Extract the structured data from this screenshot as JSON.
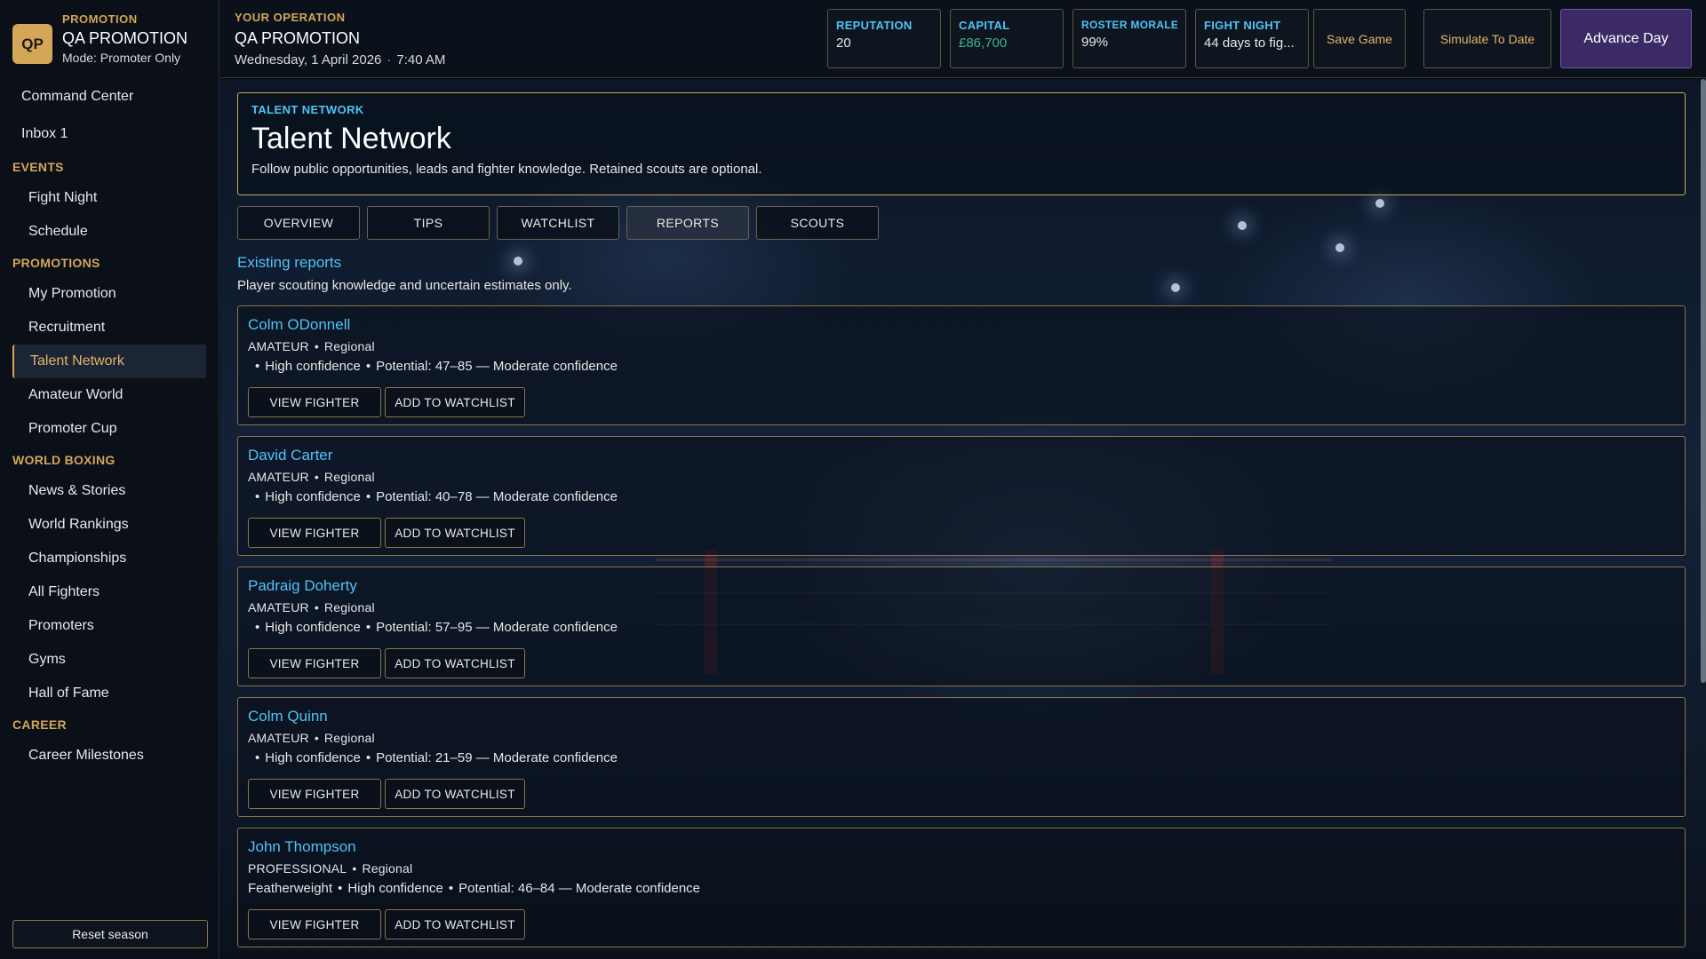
{
  "brand": {
    "logo": "QP",
    "eyebrow": "PROMOTION",
    "name": "QA PROMOTION",
    "mode": "Mode: Promoter Only"
  },
  "sidebar": {
    "top_items": [
      "Command Center",
      "Inbox 1"
    ],
    "sections": [
      {
        "title": "EVENTS",
        "items": [
          "Fight Night",
          "Schedule"
        ]
      },
      {
        "title": "PROMOTIONS",
        "items": [
          "My Promotion",
          "Recruitment",
          "Talent Network",
          "Amateur World",
          "Promoter Cup"
        ]
      },
      {
        "title": "WORLD BOXING",
        "items": [
          "News & Stories",
          "World Rankings",
          "Championships",
          "All Fighters",
          "Promoters",
          "Gyms",
          "Hall of Fame"
        ]
      },
      {
        "title": "CAREER",
        "items": [
          "Career Milestones"
        ]
      }
    ],
    "active_item": "Talent Network",
    "reset_label": "Reset season"
  },
  "topbar": {
    "eyebrow": "YOUR OPERATION",
    "name": "QA PROMOTION",
    "date": "Wednesday, 1 April 2026",
    "time": "7:40 AM",
    "stats": [
      {
        "label": "REPUTATION",
        "value": "20"
      },
      {
        "label": "CAPITAL",
        "value": "£86,700"
      },
      {
        "label": "ROSTER MORALE",
        "value": "99%"
      },
      {
        "label": "FIGHT NIGHT",
        "value": "44 days to fig..."
      }
    ],
    "save_label": "Save Game",
    "simulate_label": "Simulate To Date",
    "advance_label": "Advance Day",
    "accent_green": "#39b58a"
  },
  "hero": {
    "eyebrow": "TALENT NETWORK",
    "title": "Talent Network",
    "description": "Follow public opportunities, leads and fighter knowledge. Retained scouts are optional."
  },
  "tabs": [
    "OVERVIEW",
    "TIPS",
    "WATCHLIST",
    "REPORTS",
    "SCOUTS"
  ],
  "active_tab": "REPORTS",
  "reports": {
    "title": "Existing reports",
    "subtitle": "Player scouting knowledge and uncertain estimates only.",
    "view_label": "VIEW FIGHTER",
    "watch_label": "ADD TO WATCHLIST",
    "items": [
      {
        "name": "Colm ODonnell",
        "status": "AMATEUR",
        "scope": "Regional",
        "weight": "",
        "confidence": "High confidence",
        "potential": "Potential: 47–85 — Moderate confidence"
      },
      {
        "name": "David Carter",
        "status": "AMATEUR",
        "scope": "Regional",
        "weight": "",
        "confidence": "High confidence",
        "potential": "Potential: 40–78 — Moderate confidence"
      },
      {
        "name": "Padraig Doherty",
        "status": "AMATEUR",
        "scope": "Regional",
        "weight": "",
        "confidence": "High confidence",
        "potential": "Potential: 57–95 — Moderate confidence"
      },
      {
        "name": "Colm Quinn",
        "status": "AMATEUR",
        "scope": "Regional",
        "weight": "",
        "confidence": "High confidence",
        "potential": "Potential: 21–59 — Moderate confidence"
      },
      {
        "name": "John Thompson",
        "status": "PROFESSIONAL",
        "scope": "Regional",
        "weight": "Featherweight",
        "confidence": "High confidence",
        "potential": "Potential: 46–84 — Moderate confidence"
      }
    ]
  },
  "colors": {
    "gold": "#d4a657",
    "cyan": "#4fc3f7",
    "purple": "#3b2a66"
  }
}
